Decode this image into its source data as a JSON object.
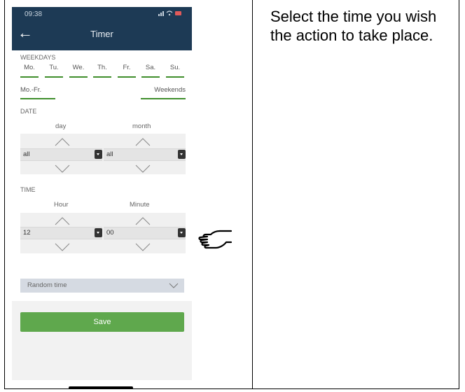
{
  "instruction": "Select the time you wish the action to take place.",
  "statusbar": {
    "time": "09:38",
    "icons": "signal wifi battery"
  },
  "navbar": {
    "back_icon": "arrow-left-icon",
    "title": "Timer"
  },
  "weekdays": {
    "label": "WEEKDAYS",
    "days": [
      "Mo.",
      "Tu.",
      "We.",
      "Th.",
      "Fr.",
      "Sa.",
      "Su."
    ],
    "presets": [
      "Mo.-Fr.",
      "Weekends"
    ]
  },
  "date": {
    "label": "DATE",
    "day_label": "day",
    "month_label": "month",
    "day_value": "all",
    "month_value": "all"
  },
  "time": {
    "label": "TIME",
    "hour_label": "Hour",
    "minute_label": "Minute",
    "hour_value": "12",
    "minute_value": "00"
  },
  "random": {
    "label": "Random time"
  },
  "save_label": "Save",
  "colors": {
    "header": "#1d3a55",
    "accent_green": "#5fa84d",
    "underline_green": "#3f8e2c"
  }
}
